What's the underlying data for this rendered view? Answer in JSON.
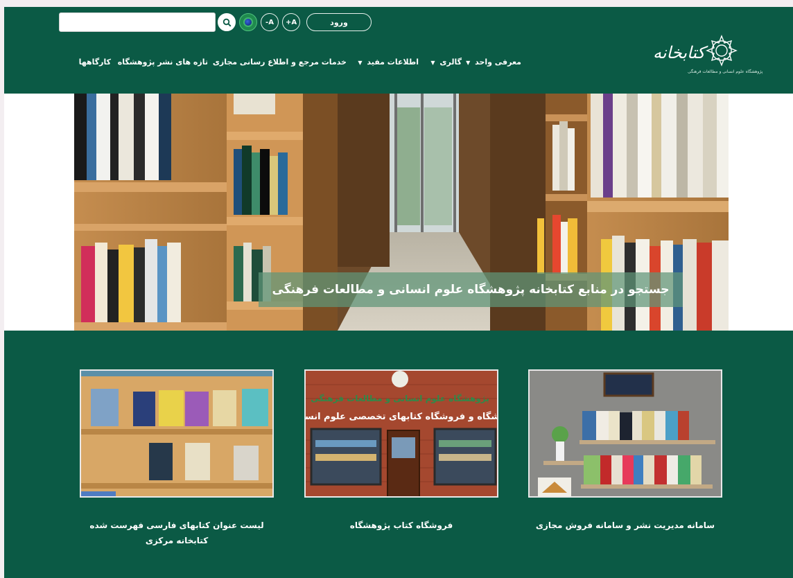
{
  "header": {
    "search": {
      "placeholder": "",
      "value": ""
    },
    "font_increase_label": "+A",
    "font_decrease_label": "-A",
    "login_label": "ورود",
    "logo_text": "کتابخانه",
    "logo_subtitle": "پژوهشگاه علوم انسانی و مطالعات فرهنگی"
  },
  "nav": {
    "items": [
      {
        "label": "معرفی واحد",
        "has_dropdown": true
      },
      {
        "label": "گالری",
        "has_dropdown": true
      },
      {
        "label": "اطلاعات مفید",
        "has_dropdown": true
      },
      {
        "label": "خدمات مرجع و اطلاع رسانی مجازی",
        "has_dropdown": false
      },
      {
        "label": "تازه های نشر پژوهشگاه",
        "has_dropdown": false
      },
      {
        "label": "کارگاهها",
        "has_dropdown": false
      }
    ]
  },
  "hero": {
    "caption": "جستجو در منابع کتابخانه پژوهشگاه علوم انسانی و مطالعات فرهنگی"
  },
  "cards": [
    {
      "caption": "سامانه مدیریت نشر و سامانه فروش مجازی"
    },
    {
      "caption": "فروشگاه کتاب پژوهشگاه",
      "sign_line1": "پژوهشگاه علوم انسانی و مطالعات فرهنگی",
      "sign_line2": "نمایشگاه و فروشگاه کتابهای تخصصی علوم انسانی"
    },
    {
      "caption": "لیست عنوان کتابهای فارسی فهرست شده کتابخانه مرکزی"
    }
  ],
  "colors": {
    "brand_green": "#0b5a45",
    "overlay": "#60967899"
  }
}
